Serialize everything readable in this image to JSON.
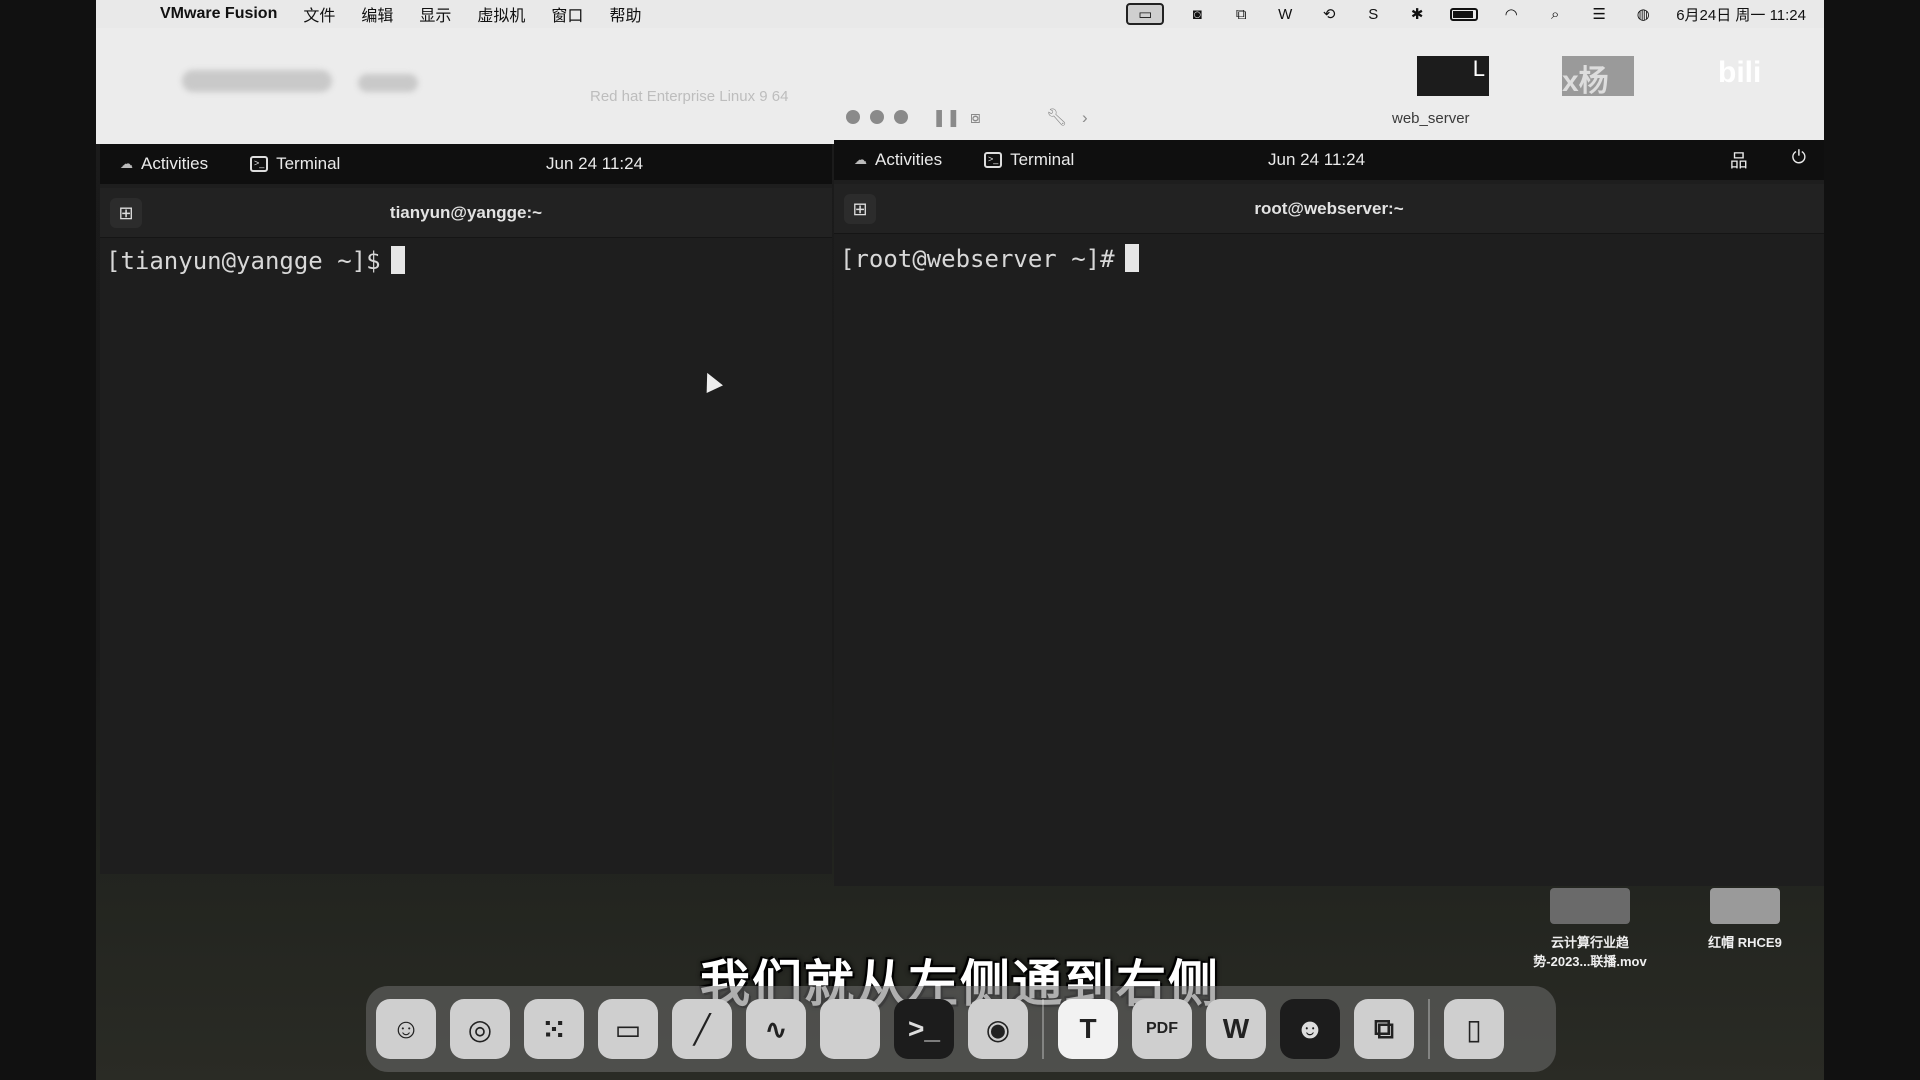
{
  "menubar": {
    "app_name": "VMware Fusion",
    "menus": [
      "文件",
      "编辑",
      "显示",
      "虚拟机",
      "窗口",
      "帮助"
    ],
    "datetime": "6月24日 周一 11:24"
  },
  "vm_toolbar": {
    "left_title": "Red hat Enterprise Linux 9 64",
    "right_title": "web_server"
  },
  "left_vm": {
    "activities": "Activities",
    "app": "Terminal",
    "clock": "Jun 24  11:24",
    "window_title": "tianyun@yangge:~",
    "prompt": "[tianyun@yangge ~]$"
  },
  "right_vm": {
    "activities": "Activities",
    "app": "Terminal",
    "clock": "Jun 24  11:24",
    "window_title": "root@webserver:~",
    "prompt": "[root@webserver ~]#"
  },
  "desktop_files": [
    {
      "name": "云计算行业趋\n势-2023...联播.mov"
    },
    {
      "name": "红帽 RHCE9"
    }
  ],
  "subtitle": "我们就从左侧通到右侧",
  "dock": {
    "items": [
      "finder",
      "safari",
      "launchpad",
      "messages",
      "pen",
      "freeform",
      "notes",
      "terminal",
      "chrome",
      "typora",
      "pdf",
      "wps",
      "chatbot",
      "vmware",
      "trash"
    ]
  }
}
